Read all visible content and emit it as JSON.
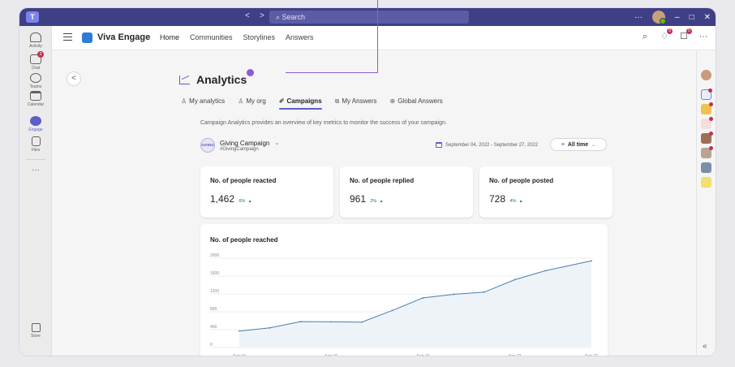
{
  "titlebar": {
    "app_icon": "teams-logo",
    "back_glyph": "<",
    "forward_glyph": ">",
    "search_placeholder": "Search",
    "more_glyph": "···",
    "minimize_glyph": "–",
    "maximize_glyph": "□",
    "close_glyph": "✕"
  },
  "rail": {
    "items": [
      {
        "label": "Activity",
        "icon": "bell-icon"
      },
      {
        "label": "Chat",
        "icon": "chat-icon",
        "badge": "3"
      },
      {
        "label": "Teams",
        "icon": "teams-icon"
      },
      {
        "label": "Calendar",
        "icon": "calendar-icon"
      },
      {
        "label": "Engage",
        "icon": "engage-icon"
      },
      {
        "label": "Files",
        "icon": "file-icon"
      }
    ],
    "more_glyph": "···",
    "store_label": "Store"
  },
  "header": {
    "app_name": "Viva Engage",
    "nav": [
      "Home",
      "Communities",
      "Storylines",
      "Answers"
    ],
    "notif_badge": "9",
    "inbox_badge": "5",
    "more_glyph": "···"
  },
  "page": {
    "back_glyph": "<",
    "title": "Analytics",
    "tabs": [
      {
        "label": "My analytics",
        "icon": "person-icon",
        "glyph": "♙"
      },
      {
        "label": "My org",
        "icon": "org-icon",
        "glyph": "♙"
      },
      {
        "label": "Campaigns",
        "icon": "campaign-icon",
        "glyph": "✐",
        "active": true
      },
      {
        "label": "My Answers",
        "icon": "answers-icon",
        "glyph": "⧉"
      },
      {
        "label": "Global Answers",
        "icon": "globe-icon",
        "glyph": "⊕"
      }
    ],
    "description": "Campaign Analytics provides an overview of key metrics to monitor the success of your campaign.",
    "campaign": {
      "avatar_text": "GIVING",
      "name": "Giving Campaign",
      "hashtag": "#GivingCampaign",
      "chevron": "⌄"
    },
    "date_range": "September 04, 2022 - September 27, 2022",
    "period": {
      "filter_glyph": "≡",
      "label": "All time",
      "chevron": "⌄"
    }
  },
  "metrics": [
    {
      "title": "No. of people reacted",
      "value": "1,462",
      "delta": "6%",
      "arrow": "▲"
    },
    {
      "title": "No. of people replied",
      "value": "961",
      "delta": "2%",
      "arrow": "▲"
    },
    {
      "title": "No. of people posted",
      "value": "728",
      "delta": "4%",
      "arrow": "▲"
    }
  ],
  "chart_data": {
    "type": "area",
    "title": "No. of people reached",
    "xlabel": "",
    "ylabel": "",
    "ylim": [
      0,
      2000
    ],
    "yticks": [
      0,
      400,
      800,
      1200,
      1600,
      2000
    ],
    "xticks": [
      "Sep 04",
      "Sep 10",
      "Sep 16",
      "Sep 22",
      "Sep 27"
    ],
    "x": [
      4,
      6,
      8,
      10,
      12,
      14,
      16,
      18,
      20,
      22,
      24,
      27
    ],
    "values": [
      370,
      440,
      580,
      575,
      570,
      830,
      1110,
      1190,
      1240,
      1520,
      1720,
      1940
    ],
    "color": "#4a7fb0",
    "fill": "#eef3f7"
  },
  "rrail": {
    "collapse_glyph": "«"
  }
}
